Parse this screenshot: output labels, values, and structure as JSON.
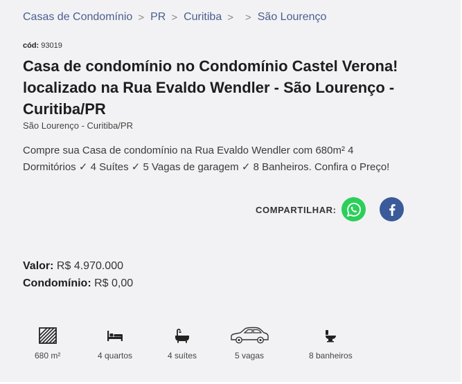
{
  "breadcrumb": {
    "items": [
      "Casas de Condomínio",
      "PR",
      "Curitiba",
      "",
      "São Lourenço"
    ],
    "separator": ">"
  },
  "listing": {
    "code_label": "cód:",
    "code": "93019",
    "title": "Casa de condomínio no Condomínio Castel Verona! localizado na Rua Evaldo Wendler - São Lourenço - Curitiba/PR",
    "location": "São Lourenço - Curitiba/PR",
    "description": "Compre sua Casa de condomínio na Rua Evaldo Wendler com 680m² 4 Dormitórios ✓ 4 Suítes ✓ 5 Vagas de garagem ✓ 8 Banheiros. Confira o Preço!"
  },
  "share": {
    "label": "COMPARTILHAR:",
    "whatsapp_icon": "whatsapp-icon",
    "facebook_icon": "facebook-icon",
    "whatsapp_color": "#2bcf5a",
    "facebook_color": "#3a5a99"
  },
  "pricing": {
    "valor_label": "Valor:",
    "valor": "R$ 4.970.000",
    "condominio_label": "Condomínio:",
    "condominio": "R$ 0,00"
  },
  "features": [
    {
      "icon": "area-icon",
      "label": "680 m²"
    },
    {
      "icon": "bed-icon",
      "label": "4 quartos"
    },
    {
      "icon": "bathtub-icon",
      "label": "4 suítes"
    },
    {
      "icon": "car-icon",
      "label": "5 vagas"
    },
    {
      "icon": "toilet-icon",
      "label": "8 banheiros"
    }
  ],
  "colors": {
    "link": "#4a5e8f",
    "background": "#f2f2f4"
  }
}
